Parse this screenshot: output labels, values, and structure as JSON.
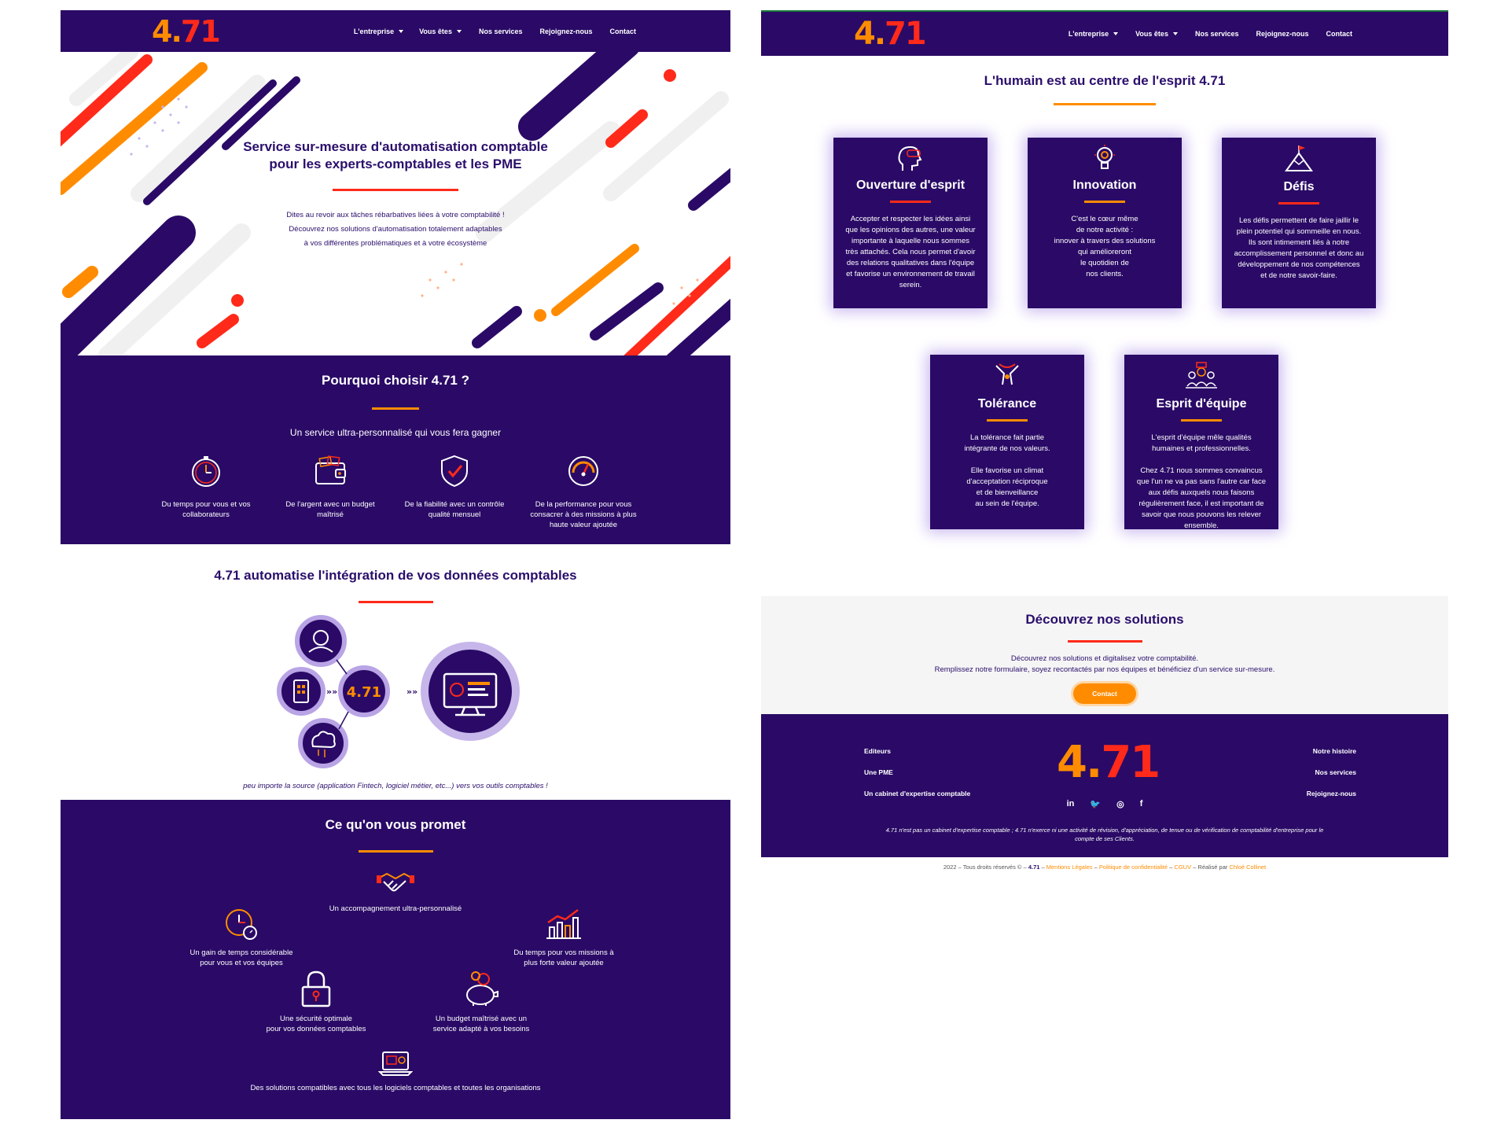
{
  "brand": {
    "logo_a": "4.",
    "logo_b": "71"
  },
  "nav": {
    "items": [
      "L'entreprise",
      "Vous êtes",
      "Nos services",
      "Rejoignez-nous",
      "Contact"
    ]
  },
  "hero": {
    "title_line1": "Service sur-mesure d'automatisation comptable",
    "title_line2": "pour les experts-comptables et les PME",
    "text_line1": "Dites au revoir aux tâches rébarbatives liées à votre comptabilité !",
    "text_line2": "Découvrez nos solutions d'automatisation totalement adaptables",
    "text_line3": "à vos différentes problématiques et à votre écosystème"
  },
  "why": {
    "title": "Pourquoi choisir 4.71 ?",
    "subtitle": "Un service ultra-personnalisé qui vous fera gagner",
    "items": [
      {
        "icon": "stopwatch-icon",
        "label": "Du temps pour vous et vos\ncollaborateurs"
      },
      {
        "icon": "wallet-icon",
        "label": "De l'argent avec un budget\nmaîtrisé"
      },
      {
        "icon": "shield-check-icon",
        "label": "De la fiabilité avec un contrôle\nqualité mensuel"
      },
      {
        "icon": "speedometer-icon",
        "label": "De la performance pour vous\nconsacrer à des missions à plus\nhaute valeur ajoutée"
      }
    ]
  },
  "automation": {
    "title": "4.71 automatise l'intégration de vos données comptables",
    "hub_label": "4.71",
    "caption": "peu importe la source (application Fintech, logiciel métier, etc...) vers vos outils comptables !"
  },
  "promise": {
    "title": "Ce qu'on vous promet",
    "items": [
      {
        "icon": "handshake-icon",
        "label": "Un accompagnement ultra-personnalisé"
      },
      {
        "icon": "clock-icon",
        "label": "Un gain de temps considérable\npour vous et vos équipes"
      },
      {
        "icon": "growth-chart-icon",
        "label": "Du temps pour vos missions à\nplus forte valeur ajoutée"
      },
      {
        "icon": "padlock-icon",
        "label": "Une sécurité optimale\npour vos données comptables"
      },
      {
        "icon": "piggy-bank-icon",
        "label": "Un budget maîtrisé avec un\nservice adapté à vos besoins"
      },
      {
        "icon": "laptop-icon",
        "label": "Des solutions compatibles avec tous les logiciels comptables et toutes les organisations"
      }
    ]
  },
  "values": {
    "title": "L'humain est au centre de l'esprit 4.71",
    "cards": [
      {
        "icon": "open-mind-icon",
        "title": "Ouverture d'esprit",
        "text": "Accepter et respecter les idées ainsi\nque les opinions des autres, une valeur\nimportante à laquelle nous sommes\ntrès attachés. Cela nous permet d'avoir\ndes relations qualitatives dans l'équipe\net favorise un environnement de travail\nserein.",
        "underline": "#ff2a1a"
      },
      {
        "icon": "lightbulb-icon",
        "title": "Innovation",
        "text": "C'est le cœur même\nde notre activité :\ninnover à travers des solutions\nqui amélioreront\nle quotidien de\nnos clients.",
        "underline": "#ff8c00"
      },
      {
        "icon": "mountain-flag-icon",
        "title": "Défis",
        "text": "Les défis permettent de faire jaillir le\nplein potentiel qui sommeille en nous.\nIls sont intimement liés à notre\naccomplissement personnel et donc au\ndéveloppement de nos compétences\net de notre savoir-faire.",
        "underline": "#ff2a1a"
      },
      {
        "icon": "hands-icon",
        "title": "Tolérance",
        "text": "La tolérance fait partie\nintégrante de nos valeurs.\n\nElle favorise un climat\nd'acceptation réciproque\net de bienveillance\nau sein de l'équipe.",
        "underline": "#ff8c00"
      },
      {
        "icon": "team-icon",
        "title": "Esprit d'équipe",
        "text": "L'esprit d'équipe mêle qualités\nhumaines et professionnelles.\n\nChez 4.71 nous sommes convaincus\nque l'un ne va pas sans l'autre car face\naux défis auxquels nous faisons\nrégulièrement face, il est important de\nsavoir que nous pouvons les relever\nensemble.",
        "underline": "#ff8c00"
      }
    ]
  },
  "discover": {
    "title": "Découvrez nos solutions",
    "line1": "Découvrez nos solutions et digitalisez votre comptabilité.",
    "line2": "Remplissez notre formulaire, soyez recontactés par nos équipes et bénéficiez d'un service sur-mesure.",
    "button": "Contact"
  },
  "footer": {
    "left": [
      "Editeurs",
      "Une PME",
      "Un cabinet d'expertise comptable"
    ],
    "right": [
      "Notre histoire",
      "Nos services",
      "Rejoignez-nous"
    ],
    "social": [
      "linkedin-icon",
      "twitter-icon",
      "instagram-icon",
      "facebook-icon"
    ],
    "social_glyphs": [
      "in",
      "🐦",
      "◎",
      "f"
    ],
    "disclaimer_line1": "4.71 n'est pas un cabinet d'expertise comptable ; 4.71 n'exerce ni une activité de révision, d'appréciation, de tenue ou de vérification de comptabilité d'entreprise pour le",
    "disclaimer_line2": "compte de ses Clients.",
    "legal_prefix": "2022 – Tous droits réservés © –",
    "legal_brand": "4.71",
    "legal_links": [
      "Mentions Légales",
      "Politique de confidentialité",
      "CGUV"
    ],
    "legal_made": "Réalisé par",
    "legal_author": "Chloé Collinet"
  },
  "colors": {
    "purple": "#2a0a66",
    "orange": "#ff8c00",
    "red": "#ff2a1a",
    "lavender": "#b9a4e6"
  }
}
